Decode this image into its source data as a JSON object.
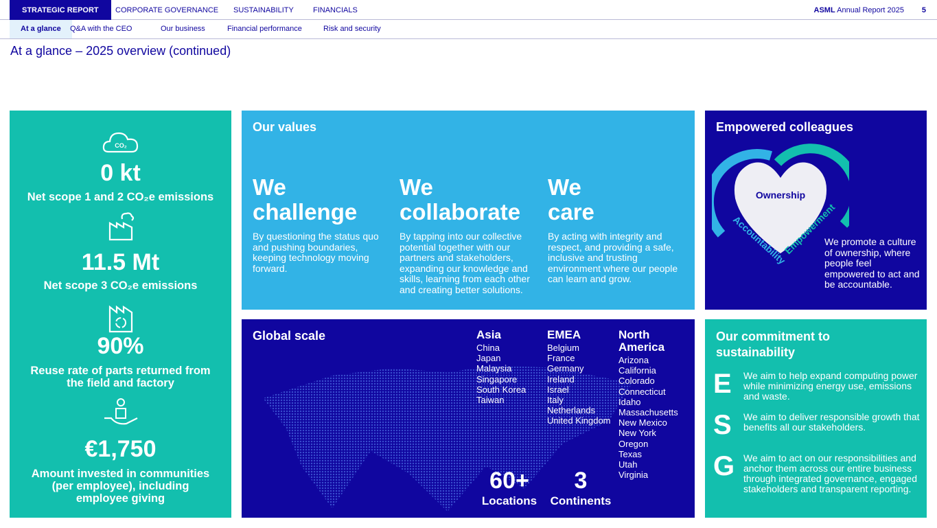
{
  "topnav": {
    "items": [
      "STRATEGIC REPORT",
      "CORPORATE GOVERNANCE",
      "SUSTAINABILITY",
      "FINANCIALS"
    ],
    "brand": "ASML",
    "report": "Annual Report 2025",
    "page": "5"
  },
  "subnav": {
    "items": [
      "At a glance",
      "Q&A with the CEO",
      "Our business",
      "Financial performance",
      "Risk and security"
    ]
  },
  "page_title": "At a glance – 2025 overview (continued)",
  "metrics": [
    {
      "icon": "co2-cloud-icon",
      "icon_text": "CO₂",
      "value": "0 kt",
      "label": "Net scope 1 and 2 CO₂e emissions"
    },
    {
      "icon": "factory-icon",
      "value": "11.5 Mt",
      "label": "Net scope 3 CO₂e emissions"
    },
    {
      "icon": "recycle-factory-icon",
      "value": "90%",
      "label": "Reuse rate of parts returned from the field and factory"
    },
    {
      "icon": "hand-person-icon",
      "value": "€1,750",
      "label": "Amount invested in communities (per employee), including employee giving"
    }
  ],
  "values": {
    "title": "Our values",
    "items": [
      {
        "heading": "We challenge",
        "text": "By questioning the status quo and pushing boundaries, keeping technology moving forward."
      },
      {
        "heading": "We collaborate",
        "text": "By tapping into our collective potential together with our partners and stakeholders, expanding our knowledge and skills, learning from each other and creating better solutions."
      },
      {
        "heading": "We care",
        "text": "By acting with integrity and respect, and providing a safe, inclusive and trusting environment where our people can learn and grow."
      }
    ]
  },
  "colleagues": {
    "title": "Empowered colleagues",
    "center": "Ownership",
    "left_arc": "Accountability",
    "right_arc": "Empowerment",
    "text": "We promote a culture of ownership, where people feel empowered to act and be accountable."
  },
  "global": {
    "title": "Global scale",
    "regions": [
      {
        "name": "Asia",
        "places": [
          "China",
          "Japan",
          "Malaysia",
          "Singapore",
          "South Korea",
          "Taiwan"
        ]
      },
      {
        "name": "EMEA",
        "places": [
          "Belgium",
          "France",
          "Germany",
          "Ireland",
          "Israel",
          "Italy",
          "Netherlands",
          "United Kingdom"
        ]
      },
      {
        "name": "North America",
        "places": [
          "Arizona",
          "California",
          "Colorado",
          "Connecticut",
          "Idaho",
          "Massachusetts",
          "New Mexico",
          "New York",
          "Oregon",
          "Texas",
          "Utah",
          "Virginia"
        ]
      }
    ],
    "stats": [
      {
        "value": "60+",
        "label": "Locations"
      },
      {
        "value": "3",
        "label": "Continents"
      }
    ]
  },
  "commitment": {
    "title": "Our commitment to sustainability",
    "items": [
      {
        "letter": "E",
        "text": "We aim to help expand computing power while minimizing energy use, emissions and waste."
      },
      {
        "letter": "S",
        "text": "We aim to deliver responsible growth that benefits all our stakeholders."
      },
      {
        "letter": "G",
        "text": "We aim to act on our responsibilities and anchor them across our entire business through integrated governance, engaged stakeholders and transparent reporting."
      }
    ]
  },
  "colors": {
    "navy": "#10069f",
    "teal": "#13bfae",
    "light_blue": "#32b3e6"
  }
}
